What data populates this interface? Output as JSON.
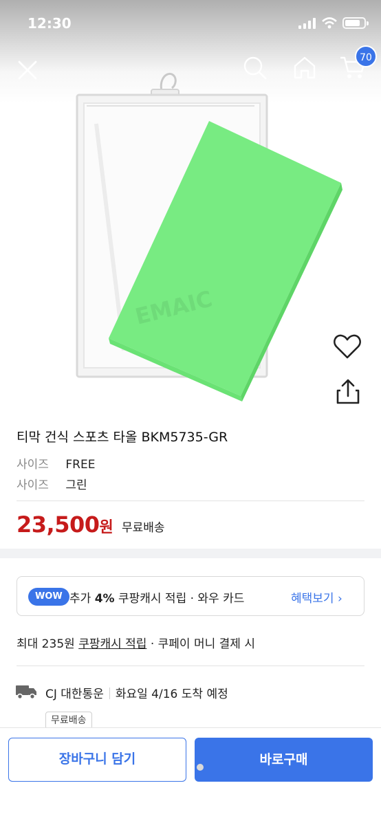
{
  "status_bar": {
    "time": "12:30"
  },
  "header": {
    "cart_count": "70"
  },
  "product": {
    "title": "티막 건식 스포츠 타올 BKM5735-GR",
    "options": [
      {
        "label": "사이즈",
        "value": "FREE"
      },
      {
        "label": "사이즈",
        "value": "그린"
      }
    ],
    "price_amount": "23,500",
    "price_unit": "원",
    "shipping_inline": "무료배송"
  },
  "wow": {
    "badge": "WOW",
    "text_prefix": "추가 ",
    "text_bold": "4%",
    "text_suffix": " 쿠팡캐시 적립 · 와우 카드",
    "link": "혜택보기 ›"
  },
  "cash": {
    "prefix": "최대 235원 ",
    "underline": "쿠팡캐시 적립",
    "suffix": " · 쿠페이 머니 결제 시"
  },
  "delivery": {
    "carrier": "CJ 대한통운",
    "arrival": "화요일 4/16 도착 예정",
    "tag": "무료배송"
  },
  "actions": {
    "cart_label": "장바구니 담기",
    "buy_label": "바로구매"
  },
  "colors": {
    "accent": "#3a74e8",
    "price": "#c61b1b",
    "towel": "#79ec83"
  },
  "icons": [
    "close-icon",
    "search-icon",
    "home-icon",
    "cart-icon",
    "heart-icon",
    "share-icon",
    "truck-icon"
  ]
}
